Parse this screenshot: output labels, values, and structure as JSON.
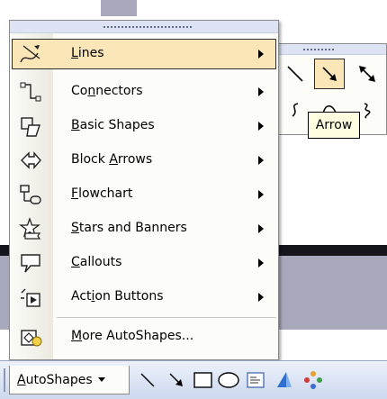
{
  "menu": {
    "items": [
      {
        "label_pre": "",
        "mnemonic": "L",
        "label_post": "ines",
        "icon": "lines-icon",
        "has_submenu": true,
        "selected": true
      },
      {
        "label_pre": "Co",
        "mnemonic": "n",
        "label_post": "nectors",
        "icon": "connectors-icon",
        "has_submenu": true
      },
      {
        "label_pre": "",
        "mnemonic": "B",
        "label_post": "asic Shapes",
        "icon": "basic-shapes-icon",
        "has_submenu": true
      },
      {
        "label_pre": "Block ",
        "mnemonic": "A",
        "label_post": "rrows",
        "icon": "block-arrows-icon",
        "has_submenu": true
      },
      {
        "label_pre": "",
        "mnemonic": "F",
        "label_post": "lowchart",
        "icon": "flowchart-icon",
        "has_submenu": true
      },
      {
        "label_pre": "",
        "mnemonic": "S",
        "label_post": "tars and Banners",
        "icon": "stars-banners-icon",
        "has_submenu": true
      },
      {
        "label_pre": "",
        "mnemonic": "C",
        "label_post": "allouts",
        "icon": "callouts-icon",
        "has_submenu": true
      },
      {
        "label_pre": "Act",
        "mnemonic": "i",
        "label_post": "on Buttons",
        "icon": "action-buttons-icon",
        "has_submenu": true
      },
      {
        "label_pre": "",
        "mnemonic": "M",
        "label_post": "ore AutoShapes...",
        "icon": "more-autoshapes-icon",
        "has_submenu": false
      }
    ]
  },
  "submenu": {
    "tooltip": "Arrow",
    "tools": [
      "line-icon",
      "arrow-icon",
      "double-arrow-icon",
      "curve-icon",
      "freeform-icon",
      "scribble-icon"
    ]
  },
  "toolbar": {
    "autoshapes_pre": "",
    "autoshapes_mnemonic": "A",
    "autoshapes_post": "utoShapes",
    "tools": [
      "line-tool-icon",
      "arrow-tool-icon",
      "rectangle-tool-icon",
      "oval-tool-icon",
      "text-box-tool-icon",
      "wordart-tool-icon",
      "diagram-tool-icon"
    ]
  },
  "colors": {
    "highlight": "#fbe6b8",
    "tooltip_bg": "#fffee1",
    "toolbar_bg": "#cdd8ee",
    "grip_bg": "#dde3f2"
  }
}
